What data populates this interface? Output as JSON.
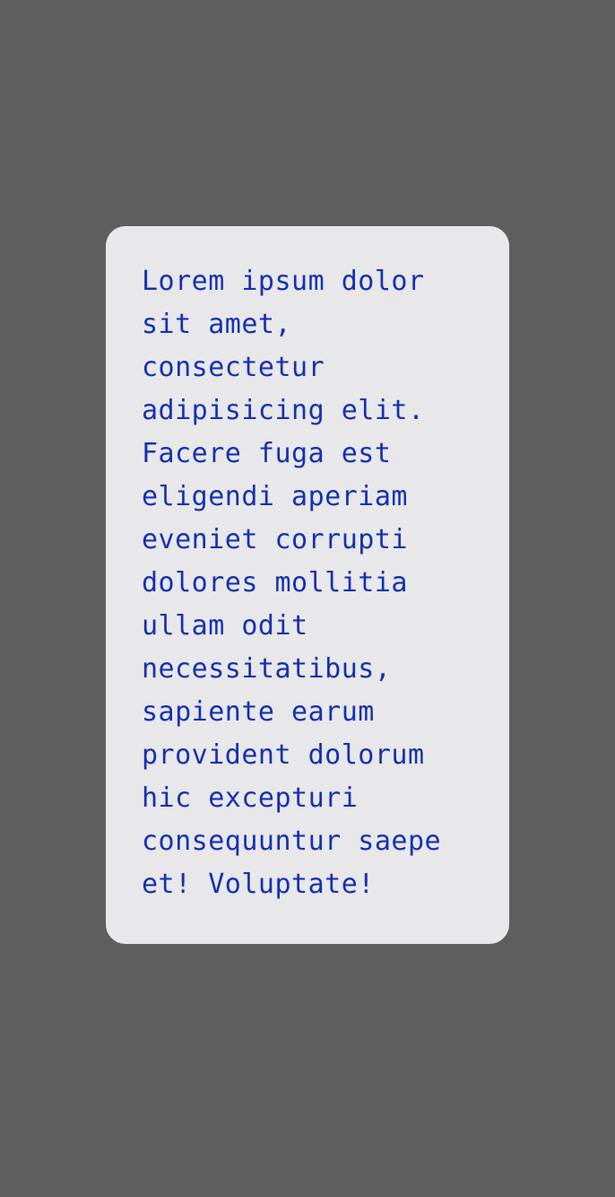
{
  "card": {
    "text": "Lorem ipsum dolor\nsit amet,\nconsectetur\nadipisicing elit.\nFacere fuga est\neligendi aperiam\neveniet corrupti\ndolores mollitia\nullam odit\nnecessitatibus,\nsapiente earum\nprovident dolorum\nhic excepturi\nconsequuntur saepe\net! Voluptate!"
  },
  "colors": {
    "background": "#5e5e5e",
    "card": "#e8e7ea",
    "text": "#1532b0"
  }
}
